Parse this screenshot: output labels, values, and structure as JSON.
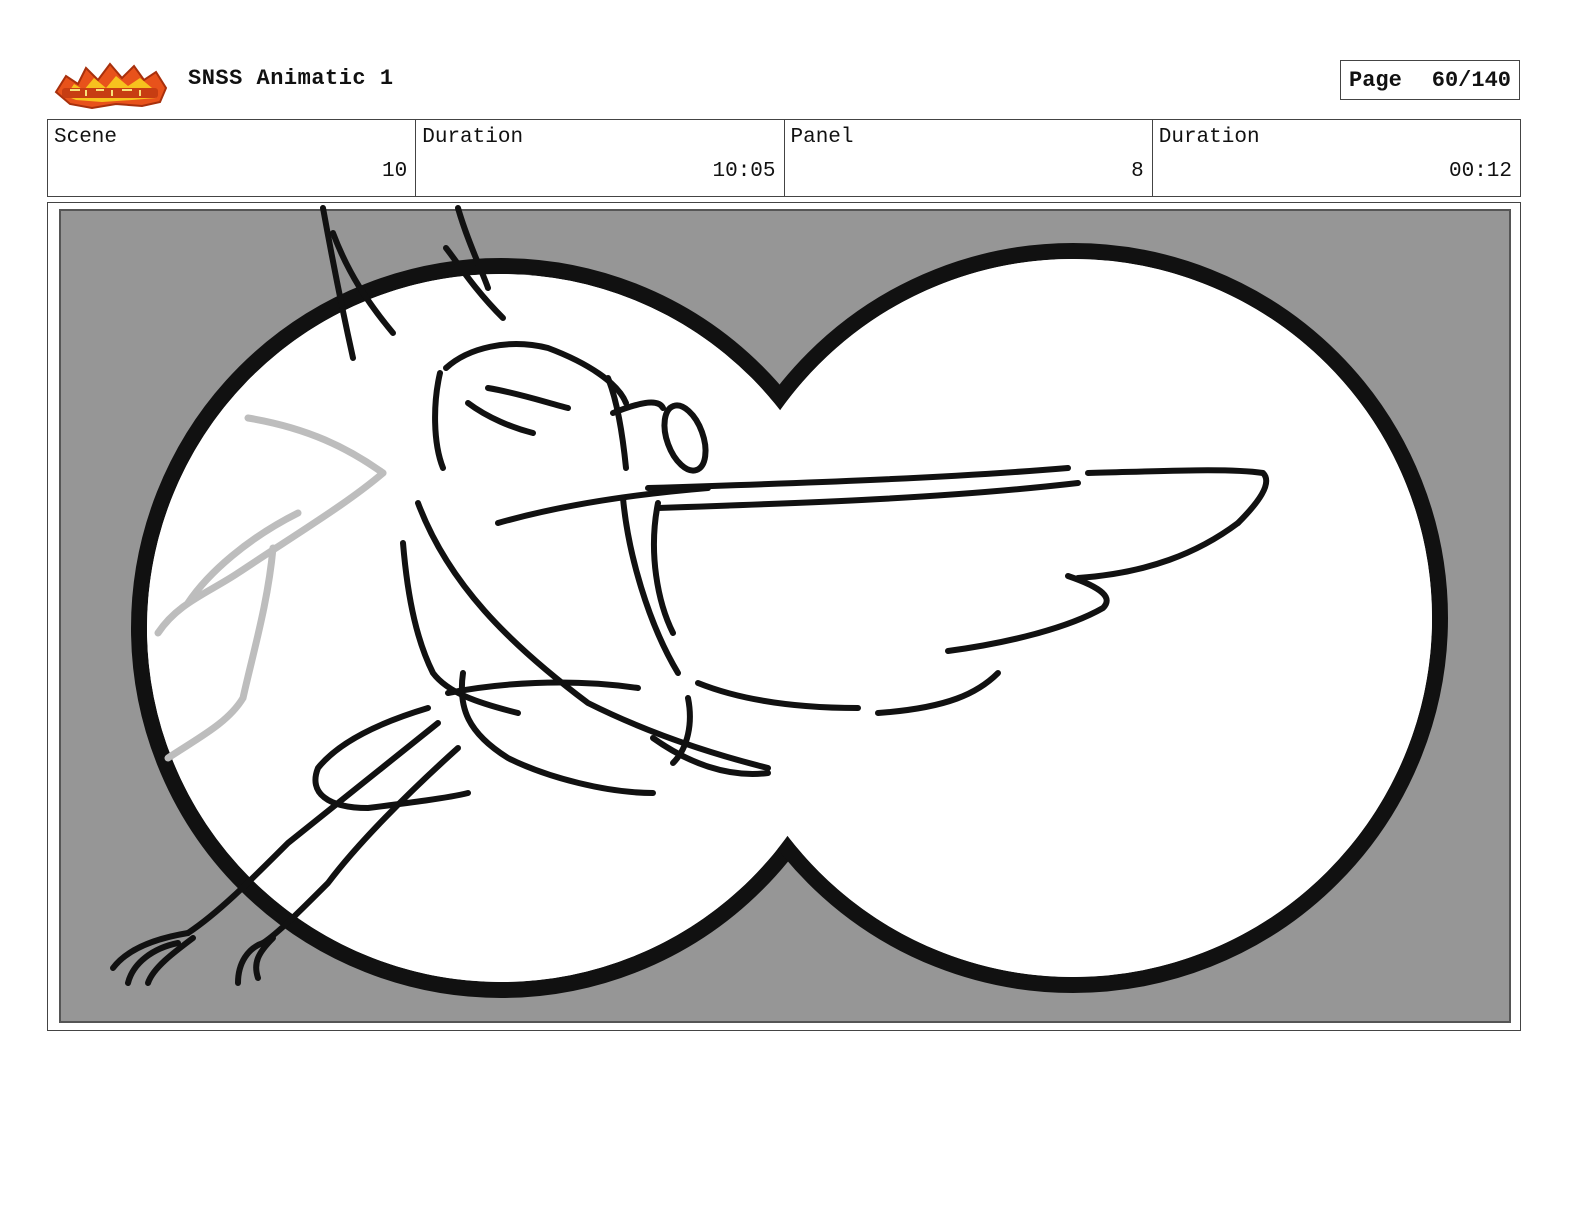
{
  "header": {
    "logo_icon": "show-logo-icon",
    "title": "SNSS Animatic 1",
    "page_label": "Page",
    "page_value": "60/140"
  },
  "info": {
    "scene_label": "Scene",
    "scene_value": "10",
    "scene_duration_label": "Duration",
    "scene_duration_value": "10:05",
    "panel_label": "Panel",
    "panel_value": "8",
    "panel_duration_label": "Duration",
    "panel_duration_value": "00:12"
  },
  "colors": {
    "panel_background": "#969696",
    "ink": "#111111",
    "sketch_gray": "#bdbdbd",
    "logo_orange": "#e8521b",
    "logo_yellow": "#f7c21e"
  }
}
